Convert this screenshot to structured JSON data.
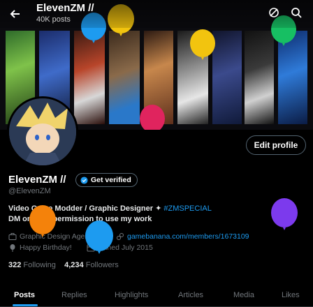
{
  "header": {
    "name": "ElevenZM //",
    "posts_count": "40K posts"
  },
  "profile": {
    "display_name": "ElevenZM //",
    "verify_label": "Get verified",
    "handle": "@ElevenZM",
    "bio_line1": "Video Game Modder / Graphic Designer ✦",
    "bio_hashtag": "#ZMSPECIAL",
    "bio_line2": "DM only for permission to use my work",
    "category": "Graphic Design Agency",
    "website": "gamebanana.com/members/1673109",
    "birthday": "Happy Birthday!",
    "joined": "Joined July 2015",
    "following_count": "322",
    "following_label": "Following",
    "followers_count": "4,234",
    "followers_label": "Followers",
    "edit_label": "Edit profile"
  },
  "tabs": [
    "Posts",
    "Replies",
    "Highlights",
    "Articles",
    "Media",
    "Likes"
  ],
  "colors": {
    "accent": "#1d9bf0",
    "balloon_yellow": "#f2c40f",
    "balloon_blue": "#1d9bf0",
    "balloon_pink": "#e0245e",
    "balloon_green": "#17bf63",
    "balloon_orange": "#f4820b",
    "balloon_purple": "#7c3aed"
  },
  "icons": [
    "back-arrow-icon",
    "shuffle-icon",
    "search-icon",
    "verified-badge-icon",
    "briefcase-icon",
    "link-icon",
    "balloon-icon",
    "calendar-icon"
  ]
}
